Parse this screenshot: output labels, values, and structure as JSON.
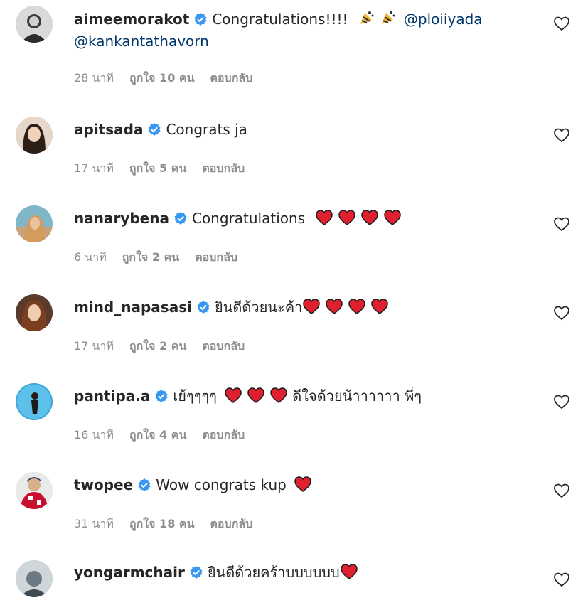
{
  "comments": [
    {
      "username": "aimeemorakot",
      "text": "Congratulations!!!!",
      "mention1": "@ploiiyada",
      "mention2": "@kankantathavorn",
      "time": "28 นาที",
      "likes": "ถูกใจ 10 คน",
      "reply": "ตอบกลับ"
    },
    {
      "username": "apitsada",
      "text": "Congrats ja",
      "time": "17 นาที",
      "likes": "ถูกใจ 5 คน",
      "reply": "ตอบกลับ"
    },
    {
      "username": "nanarybena",
      "text": "Congratulations",
      "time": "6 นาที",
      "likes": "ถูกใจ 2 คน",
      "reply": "ตอบกลับ"
    },
    {
      "username": "mind_napasasi",
      "text": "ยินดีด้วยนะค้า",
      "time": "17 นาที",
      "likes": "ถูกใจ 2 คน",
      "reply": "ตอบกลับ"
    },
    {
      "username": "pantipa.a",
      "text": "เย้ๆๆๆๆ",
      "text2": "ดีใจด้วยน้าาาาาา พี่ๆ",
      "time": "16 นาที",
      "likes": "ถูกใจ 4 คน",
      "reply": "ตอบกลับ"
    },
    {
      "username": "twopee",
      "text": "Wow congrats kup",
      "time": "31 นาที",
      "likes": "ถูกใจ 18 คน",
      "reply": "ตอบกลับ"
    },
    {
      "username": "yongarmchair",
      "text": "ยินดีด้วยคร้าบบบบบบ"
    }
  ],
  "colors": {
    "verified": "#3897f0",
    "heart": "#e0202e",
    "meta": "#8e8e8e",
    "mention": "#00376b"
  },
  "icons": {
    "verified": "verified-badge-icon",
    "like": "heart-outline-icon",
    "emoji_heart": "red-heart-emoji",
    "emoji_cone": "party-popper-emoji"
  }
}
